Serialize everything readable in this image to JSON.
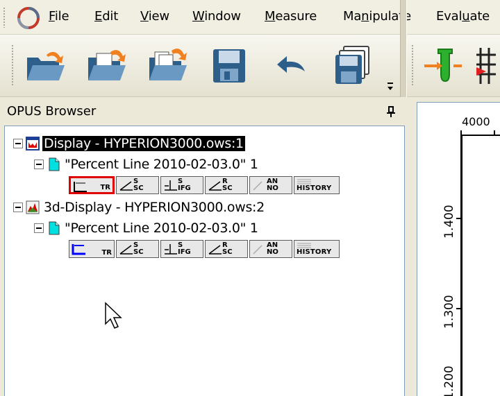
{
  "menu": {
    "items": [
      {
        "pre": "",
        "mn": "F",
        "post": "ile"
      },
      {
        "pre": "",
        "mn": "E",
        "post": "dit"
      },
      {
        "pre": "",
        "mn": "V",
        "post": "iew"
      },
      {
        "pre": "",
        "mn": "W",
        "post": "indow"
      },
      {
        "pre": "",
        "mn": "M",
        "post": "easure"
      },
      {
        "pre": "Ma",
        "mn": "n",
        "post": "ipulate"
      },
      {
        "pre": "Eval",
        "mn": "u",
        "post": "ate"
      }
    ]
  },
  "toolbar": {
    "buttons": [
      "open-icon",
      "open-folder-icon",
      "open-multiple-icon",
      "save-icon",
      "undo-icon",
      "save-all-icon",
      "measure-icon"
    ]
  },
  "browser": {
    "title": "OPUS Browser",
    "items": [
      {
        "label": "Display - HYPERION3000.ows:1",
        "selected": true
      },
      {
        "label": "\"Percent Line 2010-02-03.0\" 1"
      },
      {
        "label": "3d-Display - HYPERION3000.ows:2"
      },
      {
        "label": "\"Percent Line 2010-02-03.0\" 1"
      }
    ],
    "blocks": {
      "tr": "TR",
      "ssc": [
        "S",
        "SC"
      ],
      "sifg": [
        "S",
        "IFG"
      ],
      "rsc": [
        "R",
        "SC"
      ],
      "anno": [
        "AN",
        "NO"
      ],
      "history": "HISTORY"
    }
  },
  "plot": {
    "x_tick": "4000",
    "y_ticks": [
      "1.400",
      "1.300",
      "1.200"
    ]
  },
  "colors": {
    "selected_block_border": "#e00000",
    "teal_file": "#00e0e0",
    "active_trace_blue": "#0000ff"
  }
}
